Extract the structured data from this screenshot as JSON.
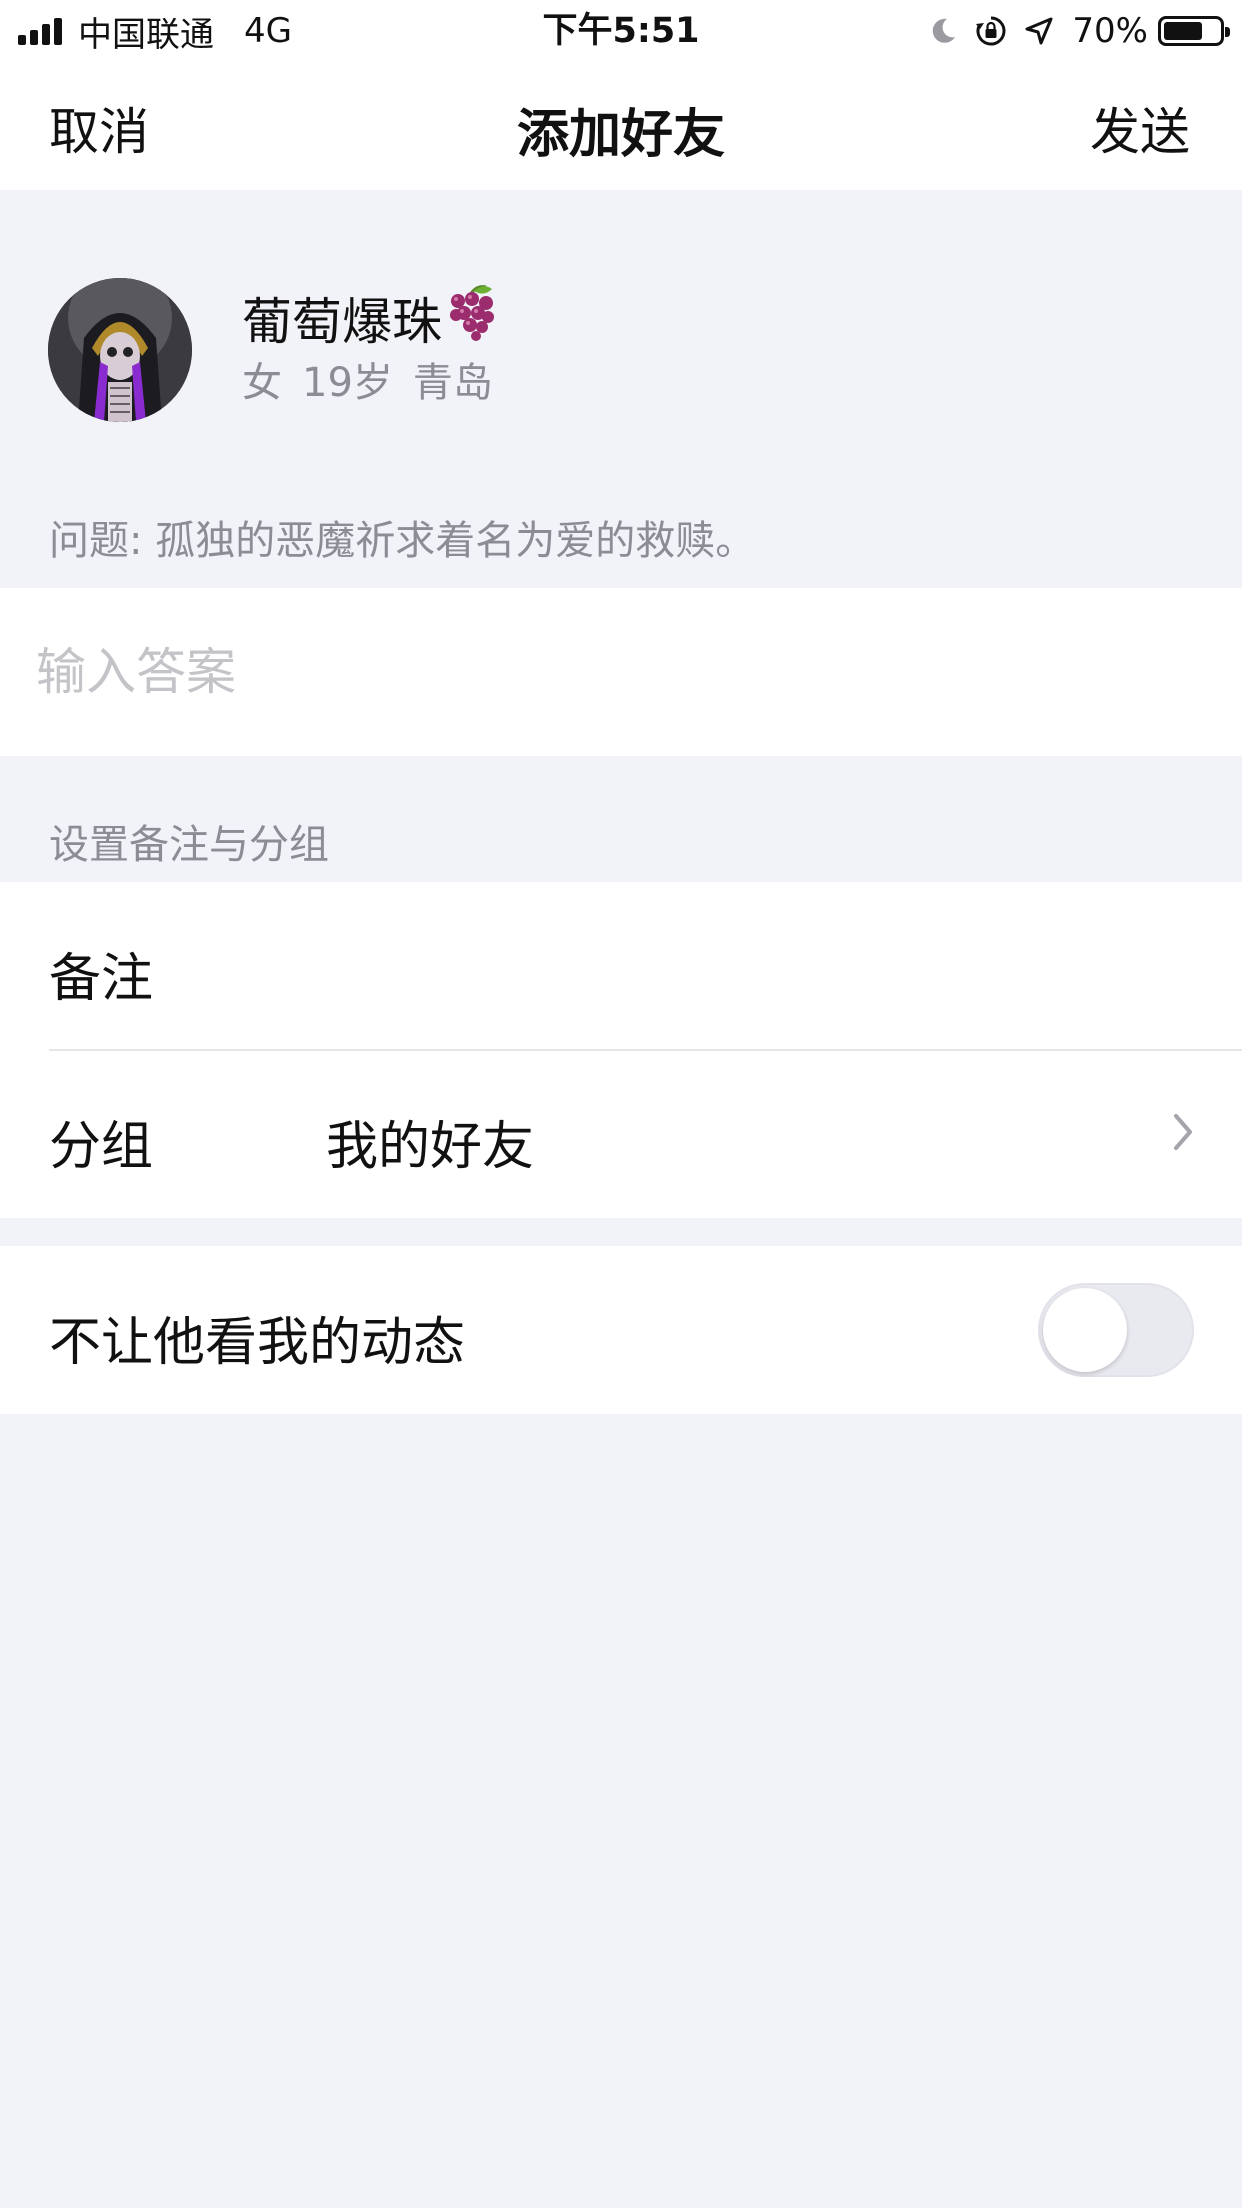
{
  "status_bar": {
    "carrier": "中国联通",
    "network": "4G",
    "time": "下午5:51",
    "battery_percent": "70%",
    "battery_level": 0.7,
    "icons": [
      "signal-icon",
      "moon-icon",
      "orientation-lock-icon",
      "location-arrow-icon",
      "battery-icon"
    ]
  },
  "nav": {
    "cancel_label": "取消",
    "title": "添加好友",
    "send_label": "发送"
  },
  "profile": {
    "nickname": "葡萄爆珠",
    "nickname_emoji_icon": "grapes-icon",
    "gender": "女",
    "age": "19岁",
    "city": "青岛",
    "question": "问题: 孤独的恶魔祈求着名为爱的救赎。"
  },
  "answer": {
    "placeholder": "输入答案",
    "value": ""
  },
  "settings": {
    "section_title": "设置备注与分组",
    "remark_label": "备注",
    "remark_value": "",
    "group_label": "分组",
    "group_value": "我的好友"
  },
  "privacy": {
    "label": "不让他看我的动态",
    "enabled": false
  },
  "colors": {
    "background": "#f2f3f8",
    "card": "#ffffff",
    "primary_text": "#111111",
    "secondary_text": "#8c8c94",
    "placeholder_text": "#c3c3c8"
  }
}
